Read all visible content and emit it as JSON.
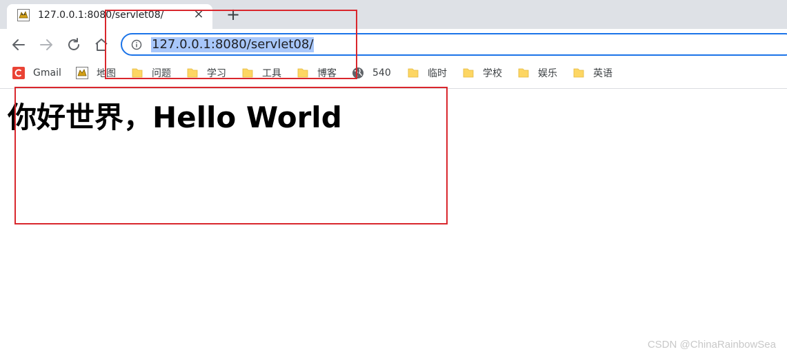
{
  "tab": {
    "title": "127.0.0.1:8080/servlet08/",
    "close_glyph": "×",
    "favicon": "tomcat-icon"
  },
  "newtab": {
    "glyph": "+"
  },
  "toolbar": {
    "back": "back-arrow-icon",
    "forward": "forward-arrow-icon",
    "reload": "reload-icon",
    "home": "home-icon",
    "url": "127.0.0.1:8080/servlet08/",
    "info": "info-icon"
  },
  "bookmarks": [
    {
      "label": "Gmail",
      "icon": "gmail-icon",
      "color": "#ea4335"
    },
    {
      "label": "地图",
      "icon": "tomcat-icon"
    },
    {
      "label": "问题",
      "icon": "folder-icon"
    },
    {
      "label": "学习",
      "icon": "folder-icon"
    },
    {
      "label": "工具",
      "icon": "folder-icon"
    },
    {
      "label": "博客",
      "icon": "folder-icon"
    },
    {
      "label": "540",
      "icon": "globe-icon"
    },
    {
      "label": "临时",
      "icon": "folder-icon"
    },
    {
      "label": "学校",
      "icon": "folder-icon"
    },
    {
      "label": "娱乐",
      "icon": "folder-icon"
    },
    {
      "label": "英语",
      "icon": "folder-icon"
    }
  ],
  "page": {
    "heading": "你好世界，Hello World"
  },
  "watermark": "CSDN @ChinaRainbowSea",
  "colors": {
    "annotation": "#d9262c",
    "omnibox_border": "#1a73e8",
    "selection": "#a8c7fa",
    "folder": "#fdd663"
  }
}
